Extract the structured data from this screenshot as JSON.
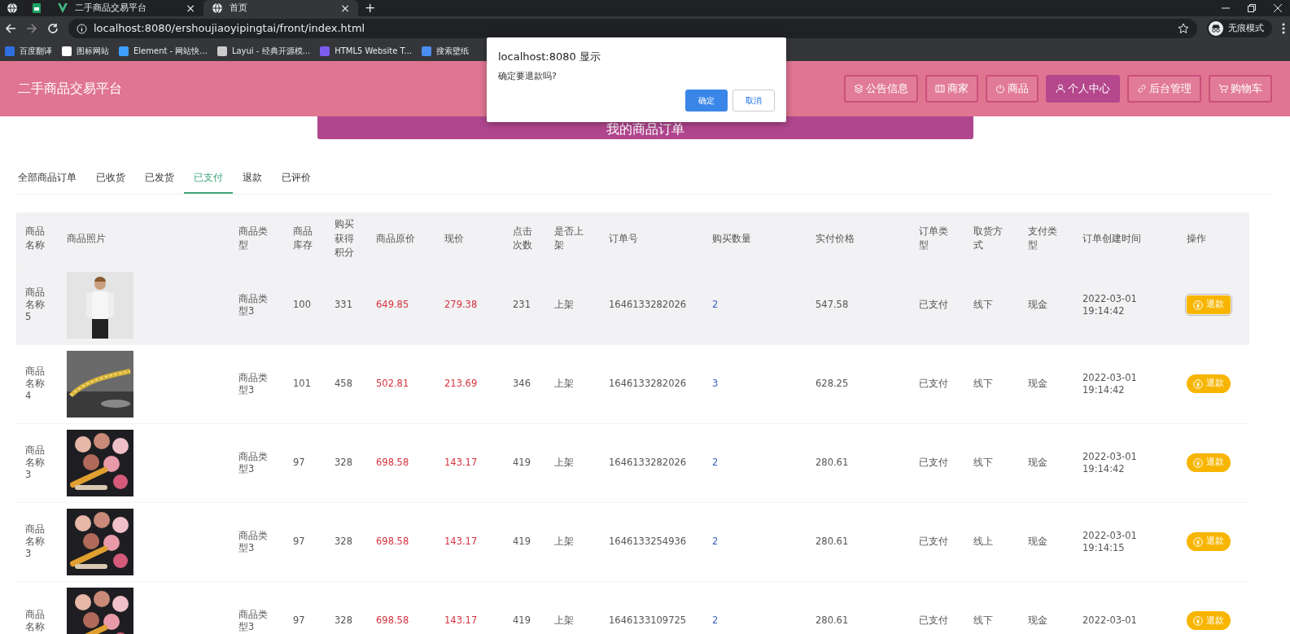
{
  "browser": {
    "tabs": [
      {
        "kind": "pinned",
        "selected": false
      },
      {
        "kind": "pinned",
        "selected": false
      },
      {
        "kind": "normal",
        "title": "二手商品交易平台",
        "close": "×",
        "selected": false
      },
      {
        "kind": "normal",
        "title": "首页",
        "close": "×",
        "selected": true
      }
    ],
    "new_tab": "+",
    "address": "localhost:8080/ershoujiaoyipingtai/front/index.html",
    "profile": "无痕模式",
    "bookmarks": [
      {
        "label": "百度翻译",
        "color": "#2f6fe0"
      },
      {
        "label": "图标网站",
        "color": "#ffffff"
      },
      {
        "label": "Element - 网站快...",
        "color": "#409eff"
      },
      {
        "label": "Layui - 经典开源模...",
        "color": "#cccccc"
      },
      {
        "label": "HTML5 Website T...",
        "color": "#7b5cf0"
      },
      {
        "label": "搜索壁纸",
        "color": "#4a8cf0"
      }
    ]
  },
  "header": {
    "title": "二手商品交易平台",
    "nav": [
      {
        "label": "公告信息",
        "selected": false
      },
      {
        "label": "商家",
        "selected": false
      },
      {
        "label": "商品",
        "selected": false
      },
      {
        "label": "个人中心",
        "selected": true
      },
      {
        "label": "后台管理",
        "selected": false
      },
      {
        "label": "购物车",
        "selected": false
      }
    ]
  },
  "banner": {
    "title": "我的商品订单"
  },
  "order_tabs": [
    {
      "label": "全部商品订单",
      "selected": false
    },
    {
      "label": "已收货",
      "selected": false
    },
    {
      "label": "已发货",
      "selected": false
    },
    {
      "label": "已支付",
      "selected": true
    },
    {
      "label": "退款",
      "selected": false
    },
    {
      "label": "已评价",
      "selected": false
    }
  ],
  "table": {
    "columns": [
      {
        "label": "商品名称",
        "kind": "text"
      },
      {
        "label": "商品照片"
      },
      {
        "label": "商品类型",
        "kind": "text"
      },
      {
        "label": "商品库存",
        "kind": "text"
      },
      {
        "label": "购买获得积分",
        "kind": "text"
      },
      {
        "label": "商品原价",
        "kind": "price"
      },
      {
        "label": "现价",
        "kind": "price"
      },
      {
        "label": "点击次数",
        "kind": "text"
      },
      {
        "label": "是否上架",
        "kind": "text"
      },
      {
        "label": "订单号",
        "kind": "text"
      },
      {
        "label": "购买数量",
        "kind": "quantity"
      },
      {
        "label": "实付价格",
        "kind": "text"
      },
      {
        "label": "订单类型",
        "kind": "text"
      },
      {
        "label": "取货方式",
        "kind": "text"
      },
      {
        "label": "支付类型",
        "kind": "text"
      },
      {
        "label": "订单创建时间",
        "kind": "text"
      },
      {
        "label": "操作",
        "kind": "action"
      }
    ],
    "rows": [
      {
        "highlighted": true,
        "cells": [
          "商品名称5",
          {
            "kind": "picture"
          },
          "商品类型3",
          "100",
          "331",
          "649.85",
          "279.38",
          "231",
          "上架",
          "1646133282026",
          "2",
          "547.58",
          "已支付",
          "线下",
          "现金",
          "2022-03-01 19:14:42",
          "退款"
        ]
      },
      {
        "highlighted": false,
        "cells": [
          "商品名称4",
          {
            "kind": "picture"
          },
          "商品类型3",
          "101",
          "458",
          "502.81",
          "213.69",
          "346",
          "上架",
          "1646133282026",
          "3",
          "628.25",
          "已支付",
          "线下",
          "现金",
          "2022-03-01 19:14:42",
          "退款"
        ]
      },
      {
        "highlighted": false,
        "cells": [
          "商品名称3",
          {
            "kind": "picture"
          },
          "商品类型3",
          "97",
          "328",
          "698.58",
          "143.17",
          "419",
          "上架",
          "1646133282026",
          "2",
          "280.61",
          "已支付",
          "线下",
          "现金",
          "2022-03-01 19:14:42",
          "退款"
        ]
      },
      {
        "highlighted": false,
        "cells": [
          "商品名称3",
          {
            "kind": "picture"
          },
          "商品类型3",
          "97",
          "328",
          "698.58",
          "143.17",
          "419",
          "上架",
          "1646133254936",
          "2",
          "280.61",
          "已支付",
          "线上",
          "现金",
          "2022-03-01 19:14:15",
          "退款"
        ]
      },
      {
        "highlighted": false,
        "cells": [
          "商品名称",
          {
            "kind": "picture"
          },
          "商品类型3",
          "97",
          "328",
          "698.58",
          "143.17",
          "419",
          "上架",
          "1646133109725",
          "2",
          "280.61",
          "已支付",
          "线下",
          "现金",
          "2022-03-01",
          "退款"
        ]
      }
    ]
  },
  "dialog": {
    "title": "localhost:8080 显示",
    "message": "确定要退款吗?",
    "buttons": [
      {
        "label": "确定",
        "kind": "primary"
      },
      {
        "label": "取消",
        "kind": "secondary"
      }
    ]
  }
}
